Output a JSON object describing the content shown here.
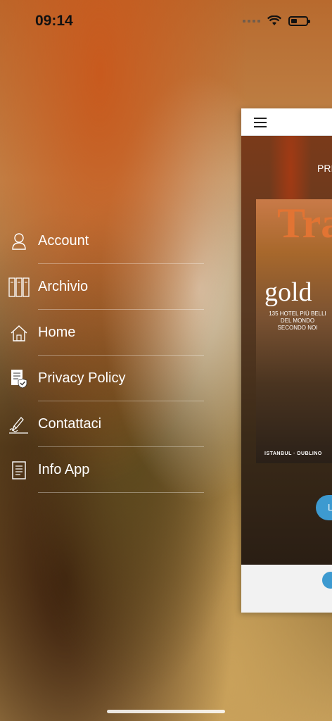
{
  "status_bar": {
    "time": "09:14"
  },
  "menu": {
    "items": [
      {
        "label": "Account",
        "icon": "person-icon"
      },
      {
        "label": "Archivio",
        "icon": "archive-icon"
      },
      {
        "label": "Home",
        "icon": "home-icon"
      },
      {
        "label": "Privacy Policy",
        "icon": "privacy-document-icon"
      },
      {
        "label": "Contattaci",
        "icon": "signature-icon"
      },
      {
        "label": "Info App",
        "icon": "info-document-icon"
      }
    ]
  },
  "preview": {
    "label": "PRI",
    "cover_title": "Tra",
    "cover_gold": "gold",
    "cover_sub": "135 HOTEL PIÙ BELLI DEL MONDO SECONDO NOI",
    "cover_bottom": "ISTANBUL · DUBLINO",
    "button_label": "L"
  },
  "colors": {
    "accent": "#3d9ad0",
    "menu_text": "#ffffff"
  }
}
